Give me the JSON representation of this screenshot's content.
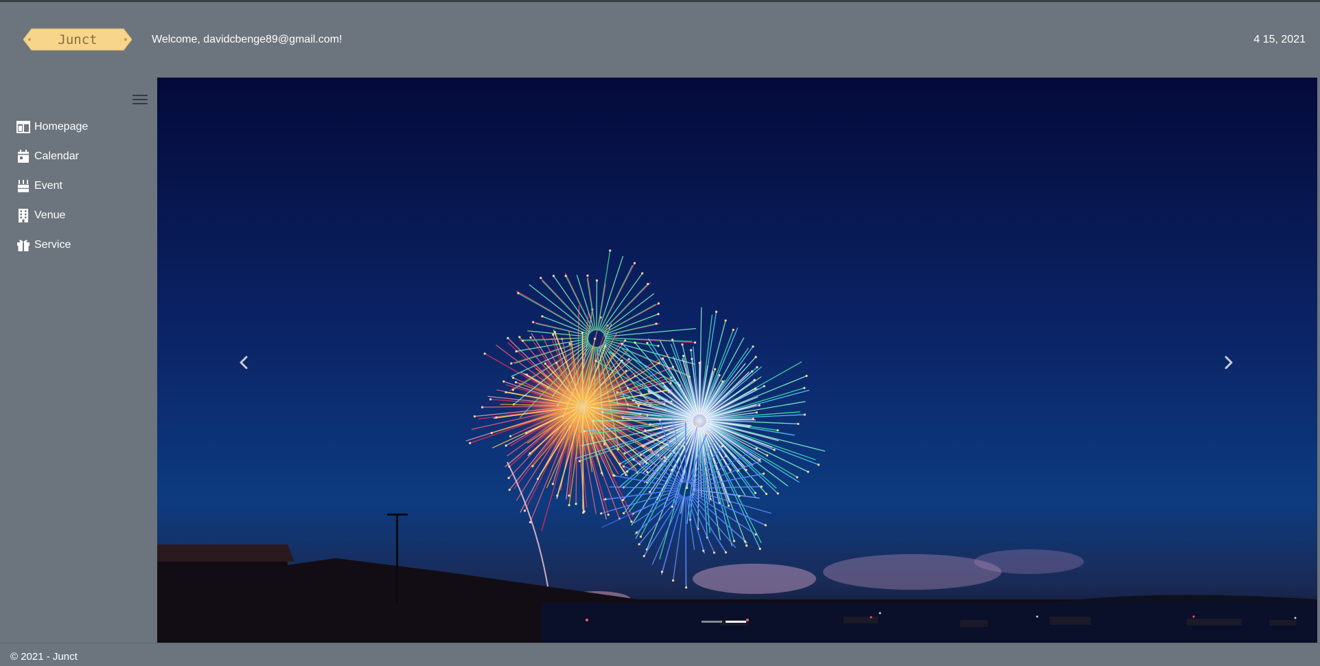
{
  "header": {
    "logo_text": "Junct",
    "welcome": "Welcome, davidcbenge89@gmail.com!",
    "date": "4 15, 2021"
  },
  "sidebar": {
    "toggle_icon": "hamburger-icon",
    "items": [
      {
        "label": "Homepage",
        "icon": "layout-icon"
      },
      {
        "label": "Calendar",
        "icon": "calendar-icon"
      },
      {
        "label": "Event",
        "icon": "birthday-cake-icon"
      },
      {
        "label": "Venue",
        "icon": "building-icon"
      },
      {
        "label": "Service",
        "icon": "gift-icon"
      }
    ]
  },
  "carousel": {
    "image": "fireworks over harbor at night",
    "prev_icon": "chevron-left-icon",
    "next_icon": "chevron-right-icon",
    "slide_count": 2,
    "active_slide": 2
  },
  "footer": {
    "text": "© 2021 - Junct"
  },
  "colors": {
    "background": "#6c757d",
    "logo_fill": "#f7d58b",
    "logo_text": "#8a6d3b",
    "sky": "#0a1f5e"
  }
}
